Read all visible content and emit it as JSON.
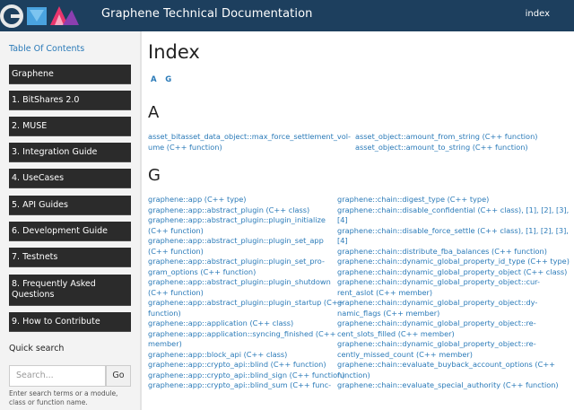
{
  "header": {
    "site_title": "Graphene Technical Documentation",
    "index_link": "index",
    "colors": {
      "bar": "#1d3f5e"
    }
  },
  "sidebar": {
    "toc_title": "Table Of Contents",
    "items": [
      "Graphene",
      "1. BitShares 2.0",
      "2. MUSE",
      "3. Integration Guide",
      "4. UseCases",
      "5. API Guides",
      "6. Development Guide",
      "7. Testnets",
      "8. Frequently Asked Questions",
      "9. How to Contribute"
    ],
    "quick_search_title": "Quick search",
    "search_placeholder": "Search...",
    "search_button": "Go",
    "search_help": "Enter search terms or a module, class or function name."
  },
  "main": {
    "title": "Index",
    "letters": [
      "A",
      "G"
    ],
    "section_a": {
      "heading": "A",
      "col1": [
        "asset_bitasset_data_object::max_force_settlement_vol-",
        "ume (C++ function)"
      ],
      "col2": [
        "asset_object::amount_from_string (C++ function)",
        "asset_object::amount_to_string (C++ function)"
      ]
    },
    "section_g": {
      "heading": "G",
      "col1": [
        "graphene::app (C++ type)",
        "graphene::app::abstract_plugin (C++ class)",
        "graphene::app::abstract_plugin::plugin_initialize",
        "(C++ function)",
        "graphene::app::abstract_plugin::plugin_set_app",
        "(C++ function)",
        "graphene::app::abstract_plugin::plugin_set_pro-",
        "gram_options (C++ function)",
        "graphene::app::abstract_plugin::plugin_shutdown",
        "(C++ function)",
        "graphene::app::abstract_plugin::plugin_startup (C++",
        "function)",
        "graphene::app::application (C++ class)",
        "graphene::app::application::syncing_finished (C++",
        "member)",
        "graphene::app::block_api (C++ class)",
        "graphene::app::crypto_api::blind (C++ function)",
        "graphene::app::crypto_api::blind_sign (C++ function)",
        "graphene::app::crypto_api::blind_sum (C++ func-"
      ],
      "col2": [
        "graphene::chain::digest_type (C++ type)",
        "graphene::chain::disable_confidential (C++ class), [1], [2], [3],",
        "[4]",
        "graphene::chain::disable_force_settle (C++ class), [1], [2], [3],",
        "[4]",
        "graphene::chain::distribute_fba_balances (C++ function)",
        "graphene::chain::dynamic_global_property_id_type (C++ type)",
        "graphene::chain::dynamic_global_property_object (C++ class)",
        "graphene::chain::dynamic_global_property_object::cur-",
        "rent_aslot (C++ member)",
        "graphene::chain::dynamic_global_property_object::dy-",
        "namic_flags (C++ member)",
        "graphene::chain::dynamic_global_property_object::re-",
        "cent_slots_filled (C++ member)",
        "graphene::chain::dynamic_global_property_object::re-",
        "cently_missed_count (C++ member)",
        "graphene::chain::evaluate_buyback_account_options (C++",
        "function)",
        "graphene::chain::evaluate_special_authority (C++ function)"
      ]
    }
  }
}
